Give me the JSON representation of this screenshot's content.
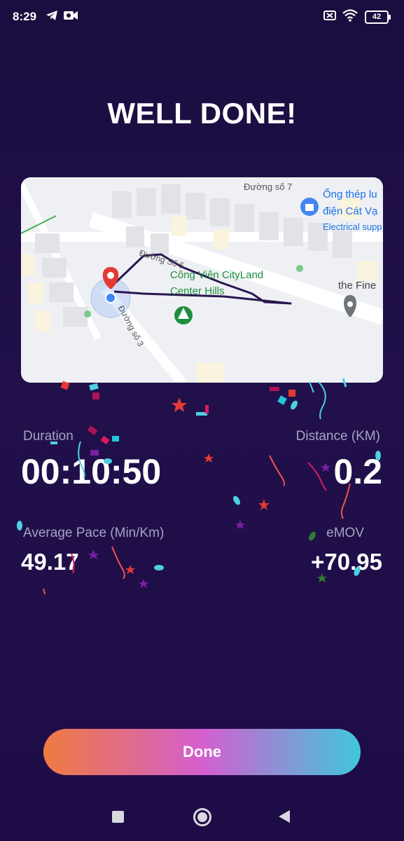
{
  "status_bar": {
    "time": "8:29",
    "battery": "42",
    "icons": [
      "telegram-icon",
      "video-camera-icon",
      "sim-off-icon",
      "wifi-icon",
      "battery-icon"
    ]
  },
  "title": "WELL DONE!",
  "map": {
    "labels": {
      "street_7": "Đường số 7",
      "street_5": "Đường Số 5",
      "street_3": "Đường số 3",
      "park_line1": "Công Viên CityLand",
      "park_line2": "Center Hills",
      "shop_line1": "Ống thép lu",
      "shop_line2": "điện Cát Vạ",
      "shop_line3": "Electrical supp",
      "poi_fine": "the Fine"
    }
  },
  "stats": {
    "duration_label": "Duration",
    "duration_value": "00:10:50",
    "distance_label": "Distance (KM)",
    "distance_value": "0.2",
    "pace_label": "Average Pace (Min/Km)",
    "pace_value": "49.17",
    "emov_label": "eMOV",
    "emov_value": "+70.95"
  },
  "done_button": "Done",
  "colors": {
    "background": "#1e0c47",
    "button_gradient_start": "#ee7b3f",
    "button_gradient_mid": "#d45fcf",
    "button_gradient_end": "#3fc7db",
    "route": "#2a1650",
    "pin": "#e53935"
  }
}
